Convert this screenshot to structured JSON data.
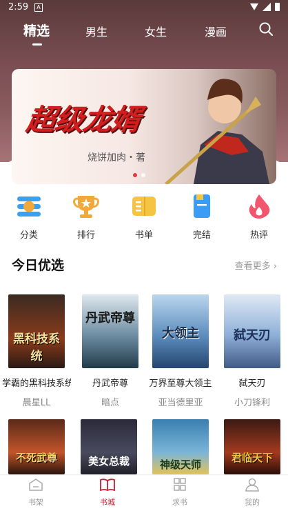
{
  "status": {
    "time": "2:59",
    "notify": "A"
  },
  "nav": {
    "tabs": [
      "精选",
      "男生",
      "女生",
      "漫画"
    ],
    "active": 0
  },
  "banner": {
    "title": "超级龙婿",
    "author": "烧饼加肉・著"
  },
  "quick": [
    {
      "label": "分类",
      "icon": "category-icon",
      "color": "#3aa0f0"
    },
    {
      "label": "排行",
      "icon": "trophy-icon",
      "color": "#f2a93b"
    },
    {
      "label": "书单",
      "icon": "booklist-icon",
      "color": "#f5c542"
    },
    {
      "label": "完结",
      "icon": "finished-book-icon",
      "color": "#3b9cf5"
    },
    {
      "label": "热评",
      "icon": "hot-comment-icon",
      "color": "#f2556e"
    }
  ],
  "section": {
    "title": "今日优选",
    "more": "查看更多"
  },
  "books": [
    {
      "title": "学霸的黑科技系统",
      "author": "晨星LL",
      "cover_text": "黑科技系统"
    },
    {
      "title": "丹武帝尊",
      "author": "暗点",
      "cover_text": "丹武帝尊"
    },
    {
      "title": "万界至尊大领主",
      "author": "亚当德里亚",
      "cover_text": "大领主"
    },
    {
      "title": "弑天刃",
      "author": "小刀锋利",
      "cover_text": "弑天刃"
    }
  ],
  "books_row2": [
    {
      "cover_text": "不死武尊"
    },
    {
      "cover_text": "美女总裁"
    },
    {
      "cover_text": "神级天师"
    },
    {
      "cover_text": "君临天下"
    }
  ],
  "bottom_nav": [
    {
      "label": "书架",
      "icon": "bookshelf-icon"
    },
    {
      "label": "书城",
      "icon": "bookstore-icon"
    },
    {
      "label": "求书",
      "icon": "request-book-icon"
    },
    {
      "label": "我的",
      "icon": "profile-icon"
    }
  ],
  "colors": {
    "accent": "#c81d2f"
  }
}
